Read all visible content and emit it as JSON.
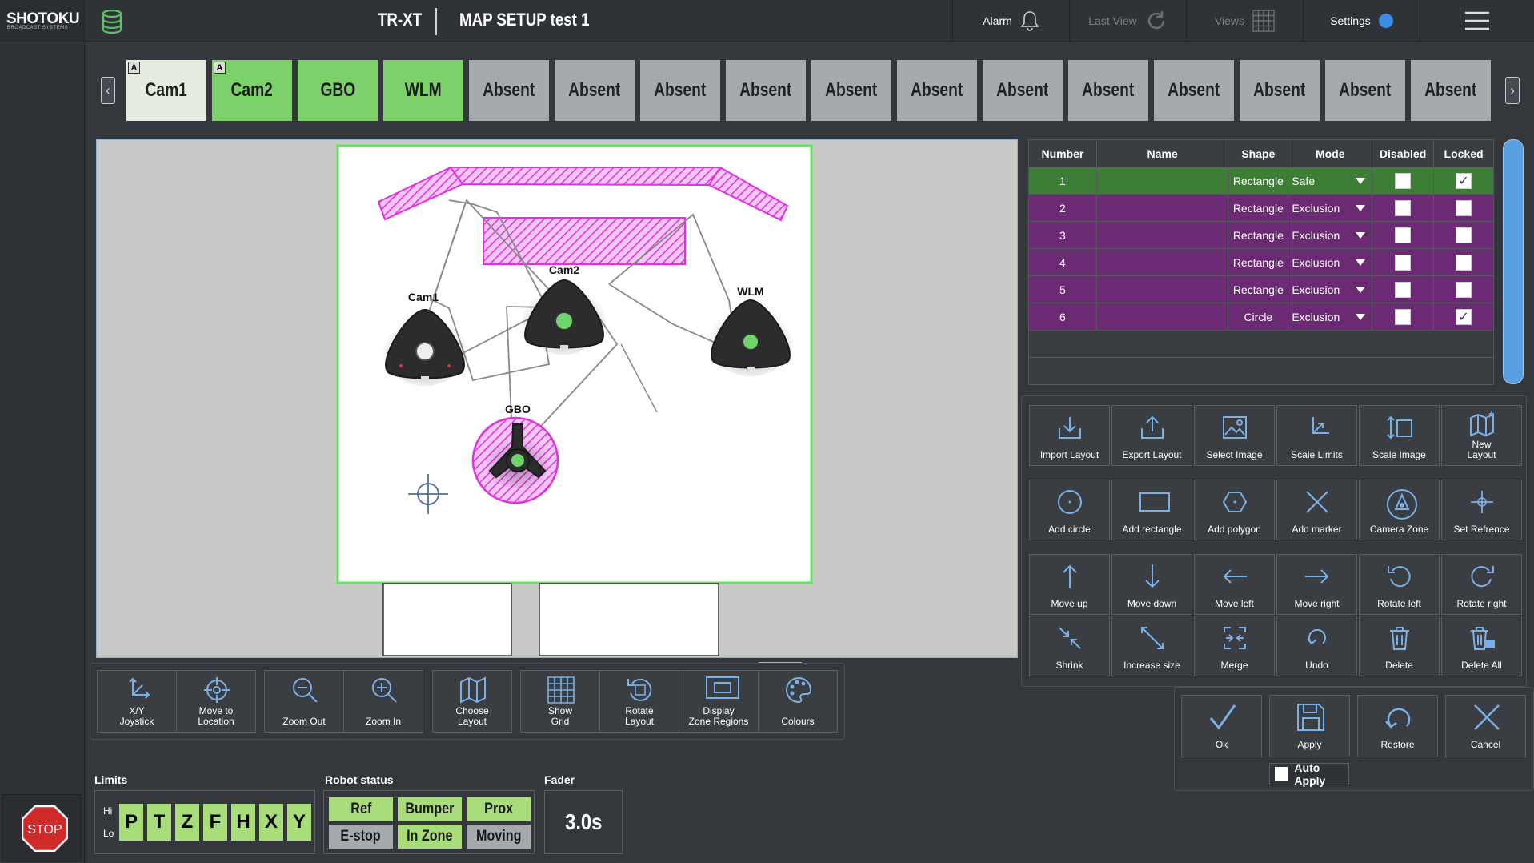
{
  "header": {
    "brand": "SHOTOKU",
    "brand_tagline": "BROADCAST SYSTEMS",
    "device": "TR-XT",
    "title": "MAP SETUP  test 1",
    "alarm_label": "Alarm",
    "last_view_label": "Last View",
    "views_label": "Views",
    "settings_label": "Settings",
    "settings_color": "#3a8de6"
  },
  "cameras": [
    {
      "label": "Cam1",
      "state": "active",
      "mark": "A"
    },
    {
      "label": "Cam2",
      "state": "green",
      "mark": "A"
    },
    {
      "label": "GBO",
      "state": "green",
      "mark": ""
    },
    {
      "label": "WLM",
      "state": "green",
      "mark": ""
    },
    {
      "label": "Absent",
      "state": "absent",
      "mark": ""
    },
    {
      "label": "Absent",
      "state": "absent",
      "mark": ""
    },
    {
      "label": "Absent",
      "state": "absent",
      "mark": ""
    },
    {
      "label": "Absent",
      "state": "absent",
      "mark": ""
    },
    {
      "label": "Absent",
      "state": "absent",
      "mark": ""
    },
    {
      "label": "Absent",
      "state": "absent",
      "mark": ""
    },
    {
      "label": "Absent",
      "state": "absent",
      "mark": ""
    },
    {
      "label": "Absent",
      "state": "absent",
      "mark": ""
    },
    {
      "label": "Absent",
      "state": "absent",
      "mark": ""
    },
    {
      "label": "Absent",
      "state": "absent",
      "mark": ""
    },
    {
      "label": "Absent",
      "state": "absent",
      "mark": ""
    },
    {
      "label": "Absent",
      "state": "absent",
      "mark": ""
    }
  ],
  "map": {
    "robots": [
      "Cam1",
      "Cam2",
      "WLM",
      "GBO"
    ],
    "zone_color": "#e030e0",
    "boundary_color": "#66e066"
  },
  "zone_table": {
    "headers": [
      "Number",
      "Name",
      "Shape",
      "Mode",
      "Disabled",
      "Locked"
    ],
    "rows": [
      {
        "number": "1",
        "name": "",
        "shape": "Rectangle",
        "mode": "Safe",
        "disabled": false,
        "locked": true
      },
      {
        "number": "2",
        "name": "",
        "shape": "Rectangle",
        "mode": "Exclusion",
        "disabled": false,
        "locked": false
      },
      {
        "number": "3",
        "name": "",
        "shape": "Rectangle",
        "mode": "Exclusion",
        "disabled": false,
        "locked": false
      },
      {
        "number": "4",
        "name": "",
        "shape": "Rectangle",
        "mode": "Exclusion",
        "disabled": false,
        "locked": false
      },
      {
        "number": "5",
        "name": "",
        "shape": "Rectangle",
        "mode": "Exclusion",
        "disabled": false,
        "locked": false
      },
      {
        "number": "6",
        "name": "",
        "shape": "Circle",
        "mode": "Exclusion",
        "disabled": false,
        "locked": true
      }
    ],
    "safe_color": "#3e7d35",
    "exclusion_color": "#6d2a74"
  },
  "tools": {
    "import_layout": "Import Layout",
    "export_layout": "Export Layout",
    "select_image": "Select Image",
    "scale_limits": "Scale Limits",
    "scale_image": "Scale Image",
    "new_layout": "New\nLayout",
    "add_circle": "Add circle",
    "add_rectangle": "Add rectangle",
    "add_polygon": "Add polygon",
    "add_marker": "Add marker",
    "camera_zone": "Camera Zone",
    "set_reference": "Set Refrence",
    "move_up": "Move up",
    "move_down": "Move down",
    "move_left": "Move left",
    "move_right": "Move right",
    "rotate_left": "Rotate left",
    "rotate_right": "Rotate right",
    "shrink": "Shrink",
    "increase_size": "Increase size",
    "merge": "Merge",
    "undo": "Undo",
    "delete": "Delete",
    "delete_all": "Delete All"
  },
  "actions": {
    "ok": "Ok",
    "apply": "Apply",
    "restore": "Restore",
    "cancel": "Cancel",
    "auto_apply": "Auto Apply",
    "auto_apply_checked": false
  },
  "bottom_tools": {
    "xy_joystick": "X/Y\nJoystick",
    "move_to_location": "Move to\nLocation",
    "zoom_out": "Zoom Out",
    "zoom_in": "Zoom In",
    "choose_layout": "Choose\nLayout",
    "show_grid": "Show\nGrid",
    "rotate_layout": "Rotate\nLayout",
    "display_zone_regions": "Display\nZone Regions",
    "colours": "Colours"
  },
  "status": {
    "limits_label": "Limits",
    "hi_label": "Hi",
    "lo_label": "Lo",
    "limits": [
      "P",
      "T",
      "Z",
      "F",
      "H",
      "X",
      "Y"
    ],
    "robot_status_label": "Robot status",
    "robot_status": [
      {
        "label": "Ref",
        "on": true
      },
      {
        "label": "Bumper",
        "on": true
      },
      {
        "label": "Prox",
        "on": true
      },
      {
        "label": "E-stop",
        "on": false
      },
      {
        "label": "In Zone",
        "on": true
      },
      {
        "label": "Moving",
        "on": false
      }
    ],
    "fader_label": "Fader",
    "fader_value": "3.0s",
    "stop_label": "STOP"
  }
}
